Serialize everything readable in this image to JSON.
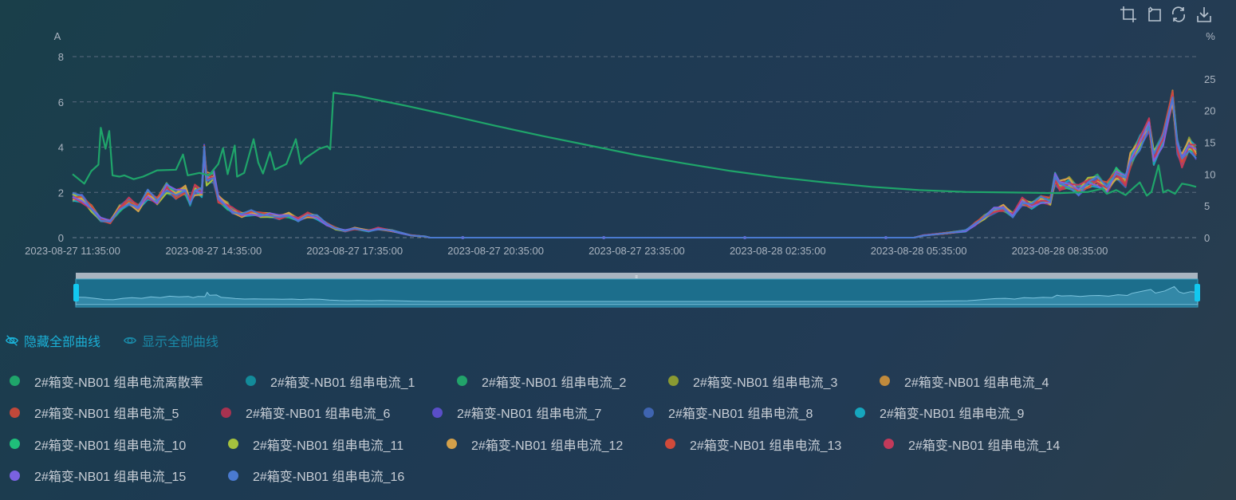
{
  "toolbox": {
    "icons": [
      "zoom-select-icon",
      "zoom-reset-icon",
      "restore-icon",
      "download-icon"
    ]
  },
  "controls": {
    "hide_all": "隐藏全部曲线",
    "show_all": "显示全部曲线",
    "hide_color": "#1bb0d6",
    "show_color": "#1a8aa8"
  },
  "legend": [
    {
      "name": "2#箱变-NB01 组串电流离散率",
      "color": "#1fa56a"
    },
    {
      "name": "2#箱变-NB01 组串电流_1",
      "color": "#138b9a"
    },
    {
      "name": "2#箱变-NB01 组串电流_2",
      "color": "#22a36a"
    },
    {
      "name": "2#箱变-NB01 组串电流_3",
      "color": "#8a9a32"
    },
    {
      "name": "2#箱变-NB01 组串电流_4",
      "color": "#c08a3c"
    },
    {
      "name": "2#箱变-NB01 组串电流_5",
      "color": "#c0483a"
    },
    {
      "name": "2#箱变-NB01 组串电流_6",
      "color": "#a83250"
    },
    {
      "name": "2#箱变-NB01 组串电流_7",
      "color": "#5a4ec8"
    },
    {
      "name": "2#箱变-NB01 组串电流_8",
      "color": "#3f64b0"
    },
    {
      "name": "2#箱变-NB01 组串电流_9",
      "color": "#16a6be"
    },
    {
      "name": "2#箱变-NB01 组串电流_10",
      "color": "#1fbf7a"
    },
    {
      "name": "2#箱变-NB01 组串电流_11",
      "color": "#a6c23e"
    },
    {
      "name": "2#箱变-NB01 组串电流_12",
      "color": "#d4a04a"
    },
    {
      "name": "2#箱变-NB01 组串电流_13",
      "color": "#d04a3a"
    },
    {
      "name": "2#箱变-NB01 组串电流_14",
      "color": "#c23a5a"
    },
    {
      "name": "2#箱变-NB01 组串电流_15",
      "color": "#7a62e0"
    },
    {
      "name": "2#箱变-NB01 组串电流_16",
      "color": "#4a7ad0"
    }
  ],
  "chart_data": {
    "type": "line",
    "yleft": {
      "unit": "A",
      "ticks": [
        0,
        2,
        4,
        6,
        8
      ],
      "range": [
        0,
        8
      ]
    },
    "yright": {
      "unit": "%",
      "ticks": [
        0,
        5,
        10,
        15,
        20,
        25
      ],
      "range": [
        0,
        28.5
      ]
    },
    "x_range_hours": [
      0,
      23.9
    ],
    "x_ticks": [
      {
        "h": 0,
        "label": "2023-08-27 11:35:00"
      },
      {
        "h": 3,
        "label": "2023-08-27 14:35:00"
      },
      {
        "h": 6,
        "label": "2023-08-27 17:35:00"
      },
      {
        "h": 9,
        "label": "2023-08-27 20:35:00"
      },
      {
        "h": 12,
        "label": "2023-08-27 23:35:00"
      },
      {
        "h": 15,
        "label": "2023-08-28 02:35:00"
      },
      {
        "h": 18,
        "label": "2023-08-28 05:35:00"
      },
      {
        "h": 21,
        "label": "2023-08-28 08:35:00"
      }
    ],
    "discrete_rate": {
      "name": "2#箱变-NB01 组串电流离散率",
      "axis": "right",
      "points": [
        [
          0,
          10
        ],
        [
          0.25,
          8.5
        ],
        [
          0.4,
          10.5
        ],
        [
          0.55,
          11.5
        ],
        [
          0.6,
          17.3
        ],
        [
          0.7,
          14
        ],
        [
          0.78,
          16.8
        ],
        [
          0.85,
          9.8
        ],
        [
          1.0,
          9.6
        ],
        [
          1.1,
          9.8
        ],
        [
          1.3,
          9.2
        ],
        [
          1.5,
          9.6
        ],
        [
          1.8,
          10.6
        ],
        [
          2.2,
          10.7
        ],
        [
          2.35,
          13.1
        ],
        [
          2.45,
          9.8
        ],
        [
          2.7,
          10.2
        ],
        [
          2.9,
          9.8
        ],
        [
          3.1,
          11.6
        ],
        [
          3.2,
          14.1
        ],
        [
          3.3,
          10
        ],
        [
          3.45,
          14.5
        ],
        [
          3.5,
          9.6
        ],
        [
          3.65,
          10.2
        ],
        [
          3.85,
          15.5
        ],
        [
          3.95,
          11.8
        ],
        [
          4.05,
          10.1
        ],
        [
          4.2,
          13.5
        ],
        [
          4.3,
          10.7
        ],
        [
          4.55,
          11.6
        ],
        [
          4.75,
          15.5
        ],
        [
          4.85,
          11.6
        ],
        [
          4.95,
          12.5
        ],
        [
          5.25,
          14
        ],
        [
          5.42,
          14.4
        ],
        [
          5.48,
          13.9
        ],
        [
          5.55,
          22.8
        ],
        [
          6,
          22.4
        ],
        [
          7,
          20.9
        ],
        [
          8,
          19.3
        ],
        [
          9,
          17.6
        ],
        [
          10,
          16.0
        ],
        [
          11,
          14.5
        ],
        [
          12,
          13.0
        ],
        [
          13,
          11.7
        ],
        [
          14,
          10.5
        ],
        [
          15,
          9.5
        ],
        [
          16,
          8.7
        ],
        [
          17,
          8.0
        ],
        [
          18,
          7.5
        ],
        [
          19,
          7.2
        ],
        [
          20,
          7.1
        ],
        [
          21,
          7.0
        ],
        [
          21.6,
          7.2
        ],
        [
          21.9,
          7.7
        ],
        [
          22,
          6.9
        ],
        [
          22.2,
          7.5
        ],
        [
          22.4,
          6.7
        ],
        [
          22.5,
          7.4
        ],
        [
          22.7,
          8.7
        ],
        [
          22.85,
          6.6
        ],
        [
          22.95,
          7.2
        ],
        [
          23.1,
          11.4
        ],
        [
          23.2,
          7.1
        ],
        [
          23.3,
          7.5
        ],
        [
          23.45,
          6.9
        ],
        [
          23.6,
          8.5
        ],
        [
          23.75,
          8.3
        ],
        [
          23.9,
          8.0
        ]
      ]
    },
    "current_profile": {
      "axis": "left",
      "points": [
        [
          0,
          1.8
        ],
        [
          0.2,
          1.7
        ],
        [
          0.4,
          1.3
        ],
        [
          0.6,
          0.8
        ],
        [
          0.8,
          0.7
        ],
        [
          1.0,
          1.3
        ],
        [
          1.2,
          1.6
        ],
        [
          1.4,
          1.3
        ],
        [
          1.6,
          1.9
        ],
        [
          1.8,
          1.6
        ],
        [
          2.0,
          2.2
        ],
        [
          2.2,
          1.9
        ],
        [
          2.4,
          2.1
        ],
        [
          2.5,
          1.6
        ],
        [
          2.6,
          2.1
        ],
        [
          2.75,
          2.0
        ],
        [
          2.8,
          3.8
        ],
        [
          2.85,
          2.6
        ],
        [
          3.0,
          2.7
        ],
        [
          3.1,
          1.7
        ],
        [
          3.3,
          1.4
        ],
        [
          3.4,
          1.2
        ],
        [
          3.6,
          1.0
        ],
        [
          3.8,
          1.1
        ],
        [
          4.0,
          1.0
        ],
        [
          4.2,
          1.0
        ],
        [
          4.4,
          0.9
        ],
        [
          4.6,
          1.0
        ],
        [
          4.8,
          0.8
        ],
        [
          5.0,
          1.0
        ],
        [
          5.2,
          0.9
        ],
        [
          5.4,
          0.6
        ],
        [
          5.6,
          0.4
        ],
        [
          5.8,
          0.3
        ],
        [
          6.0,
          0.4
        ],
        [
          6.3,
          0.3
        ],
        [
          6.5,
          0.4
        ],
        [
          6.8,
          0.3
        ],
        [
          7.0,
          0.2
        ],
        [
          7.2,
          0.1
        ],
        [
          7.5,
          0.05
        ],
        [
          7.6,
          0
        ],
        [
          17.9,
          0
        ],
        [
          18.1,
          0.1
        ],
        [
          18.6,
          0.2
        ],
        [
          19.0,
          0.3
        ],
        [
          19.2,
          0.6
        ],
        [
          19.4,
          0.9
        ],
        [
          19.6,
          1.2
        ],
        [
          19.8,
          1.3
        ],
        [
          20.0,
          1.0
        ],
        [
          20.2,
          1.6
        ],
        [
          20.4,
          1.4
        ],
        [
          20.6,
          1.7
        ],
        [
          20.8,
          1.6
        ],
        [
          20.9,
          2.6
        ],
        [
          21.0,
          2.3
        ],
        [
          21.2,
          2.4
        ],
        [
          21.4,
          2.1
        ],
        [
          21.6,
          2.4
        ],
        [
          21.8,
          2.5
        ],
        [
          22.0,
          2.2
        ],
        [
          22.2,
          2.8
        ],
        [
          22.4,
          2.5
        ],
        [
          22.5,
          3.4
        ],
        [
          22.7,
          4.2
        ],
        [
          22.9,
          5.0
        ],
        [
          23.0,
          3.5
        ],
        [
          23.2,
          4.4
        ],
        [
          23.4,
          6.2
        ],
        [
          23.5,
          4.0
        ],
        [
          23.6,
          3.4
        ],
        [
          23.75,
          4.1
        ],
        [
          23.9,
          3.8
        ]
      ]
    },
    "string_count": 16
  }
}
